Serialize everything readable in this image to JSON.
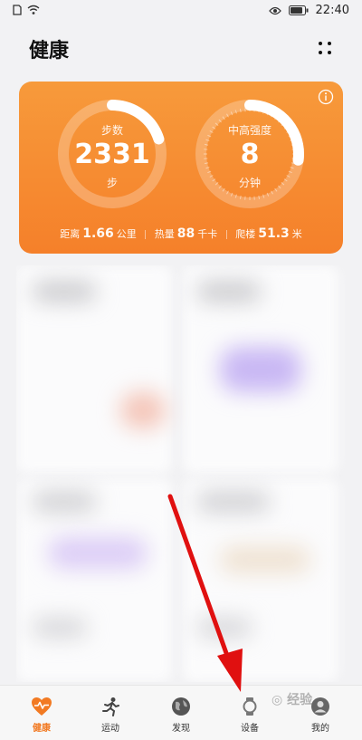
{
  "status_bar": {
    "time": "22:40"
  },
  "header": {
    "title": "健康"
  },
  "card": {
    "steps": {
      "label": "步数",
      "value": "2331",
      "unit": "步",
      "progress": 0.2
    },
    "intensity": {
      "label": "中高强度",
      "value": "8",
      "unit": "分钟",
      "progress": 0.27
    },
    "stats": [
      {
        "label": "距离",
        "value": "1.66",
        "unit": "公里"
      },
      {
        "label": "热量",
        "value": "88",
        "unit": "千卡"
      },
      {
        "label": "爬楼",
        "value": "51.3",
        "unit": "米"
      }
    ]
  },
  "tabs": [
    {
      "label": "健康",
      "icon": "heart-pulse-icon",
      "active": true
    },
    {
      "label": "运动",
      "icon": "running-icon",
      "active": false
    },
    {
      "label": "发现",
      "icon": "globe-icon",
      "active": false
    },
    {
      "label": "设备",
      "icon": "watch-icon",
      "active": false
    },
    {
      "label": "我的",
      "icon": "profile-icon",
      "active": false
    }
  ],
  "colors": {
    "accent": "#f27a23",
    "card_top": "#f79a3b",
    "card_bottom": "#f5802a",
    "arrow": "#e01010"
  }
}
